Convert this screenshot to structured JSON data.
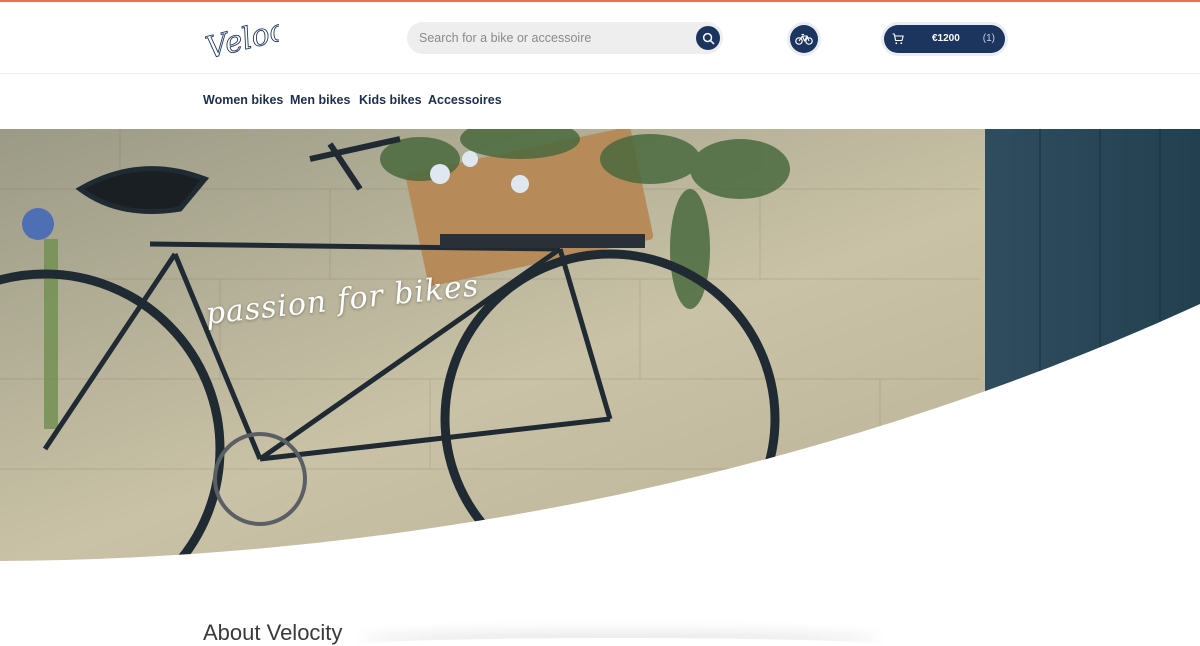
{
  "brand": {
    "logo_text": "Velocity",
    "accent_color": "#e2725b",
    "primary_color": "#1c355e"
  },
  "search": {
    "placeholder": "Search for a bike or accessoire",
    "value": "",
    "button_icon": "search-icon"
  },
  "header_actions": {
    "bike_icon": "bicycle-icon",
    "cart": {
      "icon": "cart-icon",
      "total": "€1200",
      "count": "(1)"
    }
  },
  "nav": {
    "items": [
      {
        "label": "Women bikes"
      },
      {
        "label": "Men bikes"
      },
      {
        "label": "Kids bikes"
      },
      {
        "label": "Accessoires"
      }
    ]
  },
  "hero": {
    "tagline": "passion for bikes"
  },
  "about": {
    "title": "About Velocity"
  }
}
